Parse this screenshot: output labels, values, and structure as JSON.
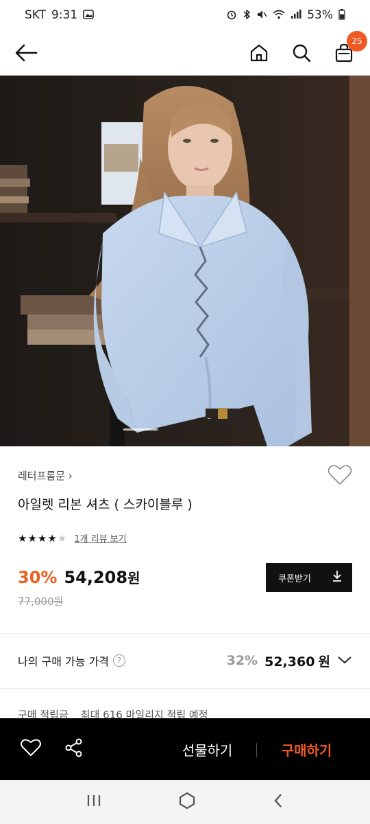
{
  "status_bar": {
    "carrier": "SKT",
    "time": "9:31",
    "battery": "53%",
    "icons": [
      "gallery-icon",
      "alarm-icon",
      "bluetooth-icon",
      "mute-icon",
      "wifi-icon",
      "signal-icon",
      "battery-icon"
    ]
  },
  "header": {
    "cart_count": "25",
    "icons": [
      "back-arrow-icon",
      "home-icon",
      "search-icon",
      "shopping-bag-icon"
    ]
  },
  "product": {
    "brand": "레터프롬문",
    "brand_chevron": "›",
    "name": "아일렛 리본 셔츠 ( 스카이블루 )",
    "rating": 4,
    "rating_max": 5,
    "review_link": "1개 리뷰 보기",
    "discount": "30%",
    "sale_price": "54,208",
    "currency": "원",
    "original_price": "77,000원",
    "coupon_label": "쿠폰받기"
  },
  "my_price": {
    "label": "나의 구매 가능 가격",
    "help": "?",
    "discount": "32%",
    "price": "52,360",
    "currency": "원"
  },
  "points": {
    "label": "구매 적립금",
    "value": "최대 616 마일리지 적립 예정"
  },
  "bottom_bar": {
    "gift_label": "선물하기",
    "buy_label": "구매하기"
  },
  "colors": {
    "accent": "#f05a22",
    "discount": "#e8601c",
    "dark": "#111111"
  }
}
